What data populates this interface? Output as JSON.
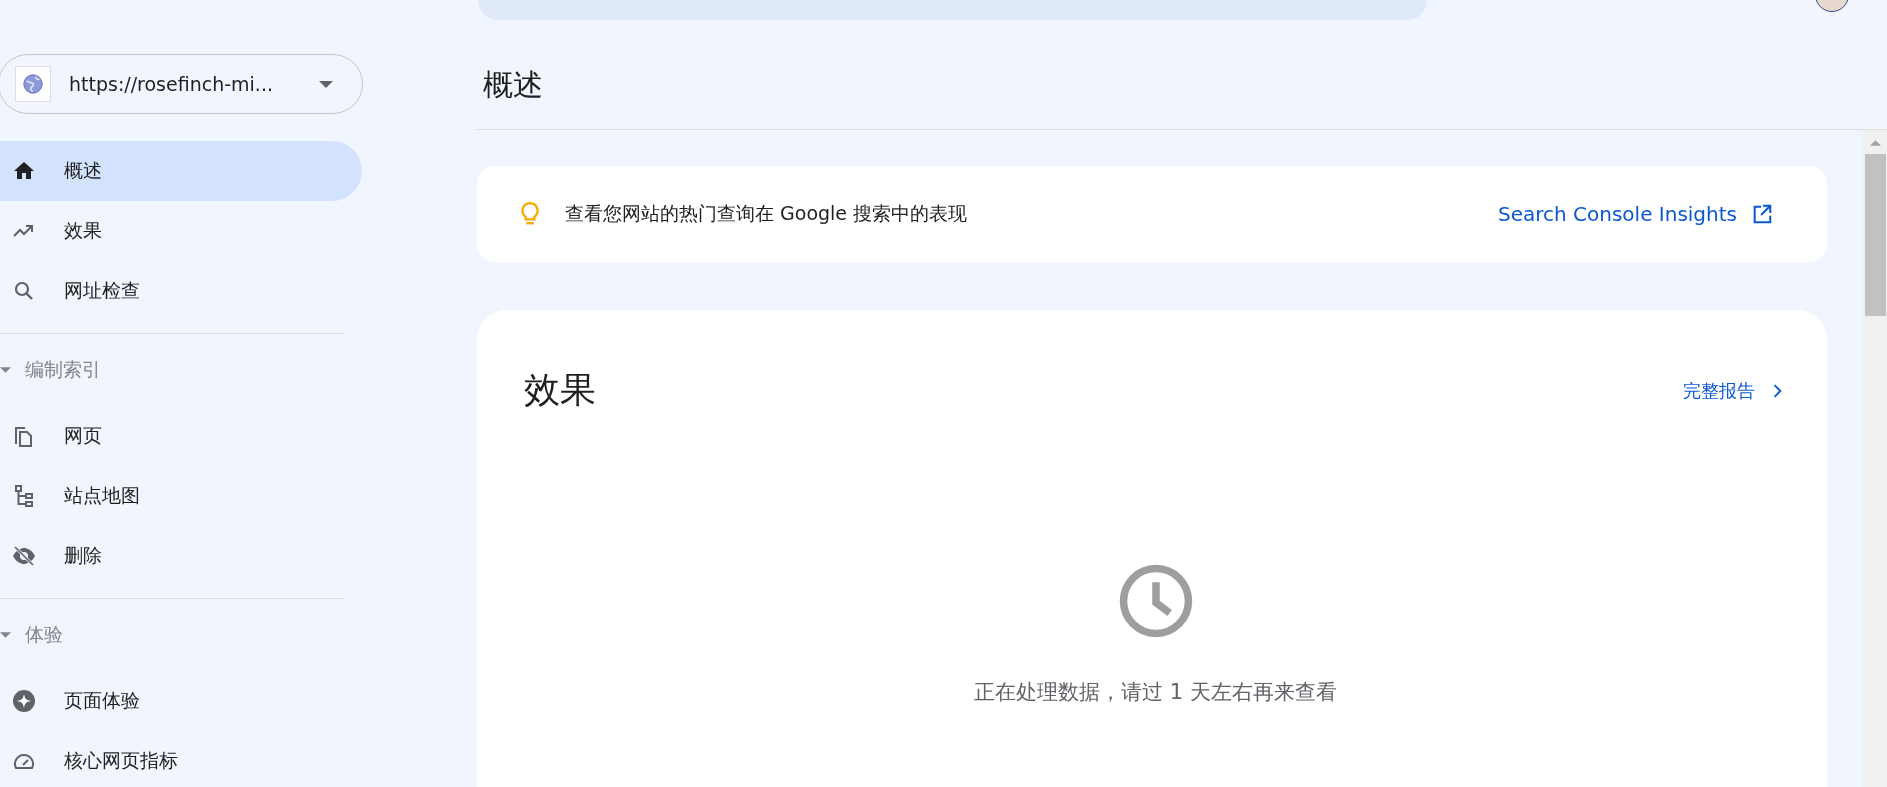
{
  "property": {
    "url": "https://rosefinch-mi..."
  },
  "nav": {
    "items": [
      {
        "label": "概述",
        "selected": true
      },
      {
        "label": "效果",
        "selected": false
      },
      {
        "label": "网址检查",
        "selected": false
      }
    ],
    "sections": [
      {
        "title": "编制索引",
        "expanded": true,
        "items": [
          {
            "label": "网页",
            "selected": false
          },
          {
            "label": "站点地图",
            "selected": false
          },
          {
            "label": "删除",
            "selected": false
          }
        ]
      },
      {
        "title": "体验",
        "expanded": true,
        "items": [
          {
            "label": "页面体验",
            "selected": false
          },
          {
            "label": "核心网页指标",
            "selected": false
          }
        ]
      }
    ]
  },
  "page_title": "概述",
  "insight": {
    "text": "查看您网站的热门查询在 Google 搜索中的表现",
    "link": "Search Console Insights"
  },
  "performance": {
    "title": "效果",
    "link": "完整报告",
    "message": "正在处理数据，请过 1 天左右再来查看"
  }
}
